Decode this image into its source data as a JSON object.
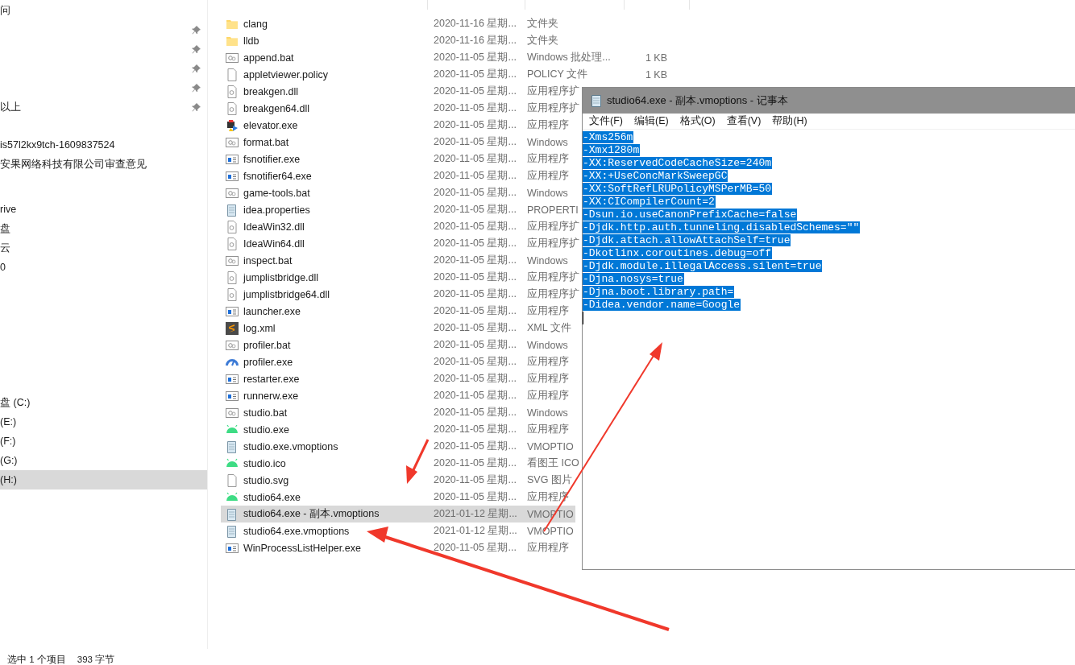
{
  "sidebar": {
    "sections": [
      {
        "items": [
          {
            "label": "问",
            "pinned": false
          },
          {
            "pinned": true
          },
          {
            "pinned": true
          },
          {
            "pinned": true
          },
          {
            "pinned": true
          },
          {
            "label": "以上",
            "pinned": true
          }
        ]
      },
      {
        "items": [
          {
            "label": "is57l2kx9tch-1609837524",
            "pinned": false
          },
          {
            "label": "安果网络科技有限公司审查意见",
            "pinned": false
          }
        ]
      },
      {
        "items": [
          {
            "label": "rive",
            "pinned": false
          },
          {
            "label": "盘",
            "pinned": false
          },
          {
            "label": "云",
            "pinned": false
          },
          {
            "label": "0",
            "pinned": false
          }
        ]
      },
      {
        "items": [
          {
            "label": "盘 (C:)",
            "pinned": false,
            "selected": false
          },
          {
            "label": "(E:)",
            "pinned": false,
            "selected": false
          },
          {
            "label": "(F:)",
            "pinned": false,
            "selected": false
          },
          {
            "label": "(G:)",
            "pinned": false,
            "selected": false
          },
          {
            "label": "(H:)",
            "pinned": false,
            "selected": true
          }
        ]
      }
    ]
  },
  "files": [
    {
      "kind": "folder",
      "name": "clang",
      "date": "2020-11-16 星期...",
      "type": "文件夹",
      "selected": false
    },
    {
      "kind": "folder",
      "name": "lldb",
      "date": "2020-11-16 星期...",
      "type": "文件夹",
      "selected": false
    },
    {
      "kind": "batch",
      "name": "append.bat",
      "date": "2020-11-05 星期...",
      "type": "Windows 批处理...",
      "size": "1 KB",
      "selected": false
    },
    {
      "kind": "file",
      "name": "appletviewer.policy",
      "date": "2020-11-05 星期...",
      "type": "POLICY 文件",
      "size": "1 KB",
      "selected": false
    },
    {
      "kind": "dll",
      "name": "breakgen.dll",
      "date": "2020-11-05 星期...",
      "type": "应用程序扩",
      "selected": false
    },
    {
      "kind": "dll",
      "name": "breakgen64.dll",
      "date": "2020-11-05 星期...",
      "type": "应用程序扩",
      "selected": false
    },
    {
      "kind": "elevator",
      "name": "elevator.exe",
      "date": "2020-11-05 星期...",
      "type": "应用程序",
      "selected": false
    },
    {
      "kind": "batch",
      "name": "format.bat",
      "date": "2020-11-05 星期...",
      "type": "Windows",
      "selected": false
    },
    {
      "kind": "exe",
      "name": "fsnotifier.exe",
      "date": "2020-11-05 星期...",
      "type": "应用程序",
      "selected": false
    },
    {
      "kind": "exe",
      "name": "fsnotifier64.exe",
      "date": "2020-11-05 星期...",
      "type": "应用程序",
      "selected": false
    },
    {
      "kind": "batch",
      "name": "game-tools.bat",
      "date": "2020-11-05 星期...",
      "type": "Windows",
      "selected": false
    },
    {
      "kind": "text",
      "name": "idea.properties",
      "date": "2020-11-05 星期...",
      "type": "PROPERTI",
      "selected": false
    },
    {
      "kind": "dll",
      "name": "IdeaWin32.dll",
      "date": "2020-11-05 星期...",
      "type": "应用程序扩",
      "selected": false
    },
    {
      "kind": "dll",
      "name": "IdeaWin64.dll",
      "date": "2020-11-05 星期...",
      "type": "应用程序扩",
      "selected": false
    },
    {
      "kind": "batch",
      "name": "inspect.bat",
      "date": "2020-11-05 星期...",
      "type": "Windows",
      "selected": false
    },
    {
      "kind": "dll",
      "name": "jumplistbridge.dll",
      "date": "2020-11-05 星期...",
      "type": "应用程序扩",
      "selected": false
    },
    {
      "kind": "dll",
      "name": "jumplistbridge64.dll",
      "date": "2020-11-05 星期...",
      "type": "应用程序扩",
      "selected": false
    },
    {
      "kind": "exe",
      "name": "launcher.exe",
      "date": "2020-11-05 星期...",
      "type": "应用程序",
      "selected": false
    },
    {
      "kind": "xml",
      "name": "log.xml",
      "date": "2020-11-05 星期...",
      "type": "XML 文件",
      "selected": false
    },
    {
      "kind": "batch",
      "name": "profiler.bat",
      "date": "2020-11-05 星期...",
      "type": "Windows",
      "selected": false
    },
    {
      "kind": "gauge",
      "name": "profiler.exe",
      "date": "2020-11-05 星期...",
      "type": "应用程序",
      "selected": false
    },
    {
      "kind": "exe",
      "name": "restarter.exe",
      "date": "2020-11-05 星期...",
      "type": "应用程序",
      "selected": false
    },
    {
      "kind": "exe",
      "name": "runnerw.exe",
      "date": "2020-11-05 星期...",
      "type": "应用程序",
      "selected": false
    },
    {
      "kind": "batch",
      "name": "studio.bat",
      "date": "2020-11-05 星期...",
      "type": "Windows",
      "selected": false
    },
    {
      "kind": "android",
      "name": "studio.exe",
      "date": "2020-11-05 星期...",
      "type": "应用程序",
      "selected": false
    },
    {
      "kind": "text",
      "name": "studio.exe.vmoptions",
      "date": "2020-11-05 星期...",
      "type": "VMOPTIO",
      "selected": false
    },
    {
      "kind": "android",
      "name": "studio.ico",
      "date": "2020-11-05 星期...",
      "type": "看图王 ICO",
      "selected": false
    },
    {
      "kind": "file",
      "name": "studio.svg",
      "date": "2020-11-05 星期...",
      "type": "SVG 图片",
      "selected": false
    },
    {
      "kind": "android",
      "name": "studio64.exe",
      "date": "2020-11-05 星期...",
      "type": "应用程序",
      "selected": false
    },
    {
      "kind": "text",
      "name": "studio64.exe - 副本.vmoptions",
      "date": "2021-01-12 星期...",
      "type": "VMOPTIO",
      "selected": true
    },
    {
      "kind": "text",
      "name": "studio64.exe.vmoptions",
      "date": "2021-01-12 星期...",
      "type": "VMOPTIO",
      "selected": false
    },
    {
      "kind": "exe",
      "name": "WinProcessListHelper.exe",
      "date": "2020-11-05 星期...",
      "type": "应用程序",
      "selected": false
    }
  ],
  "status_bar": {
    "selection": "选中 1 个项目",
    "size": "393 字节"
  },
  "notepad": {
    "title": "studio64.exe - 副本.vmoptions - 记事本",
    "menu": [
      "文件(F)",
      "编辑(E)",
      "格式(O)",
      "查看(V)",
      "帮助(H)"
    ],
    "lines": [
      "-Xms256m",
      "-Xmx1280m",
      "-XX:ReservedCodeCacheSize=240m",
      "-XX:+UseConcMarkSweepGC",
      "-XX:SoftRefLRUPolicyMSPerMB=50",
      "-XX:CICompilerCount=2",
      "-Dsun.io.useCanonPrefixCache=false",
      "-Djdk.http.auth.tunneling.disabledSchemes=\"\"",
      "-Djdk.attach.allowAttachSelf=true",
      "-Dkotlinx.coroutines.debug=off",
      "-Djdk.module.illegalAccess.silent=true",
      "-Djna.nosys=true",
      "-Djna.boot.library.path=",
      "-Didea.vendor.name=Google"
    ],
    "text_selected": true
  }
}
